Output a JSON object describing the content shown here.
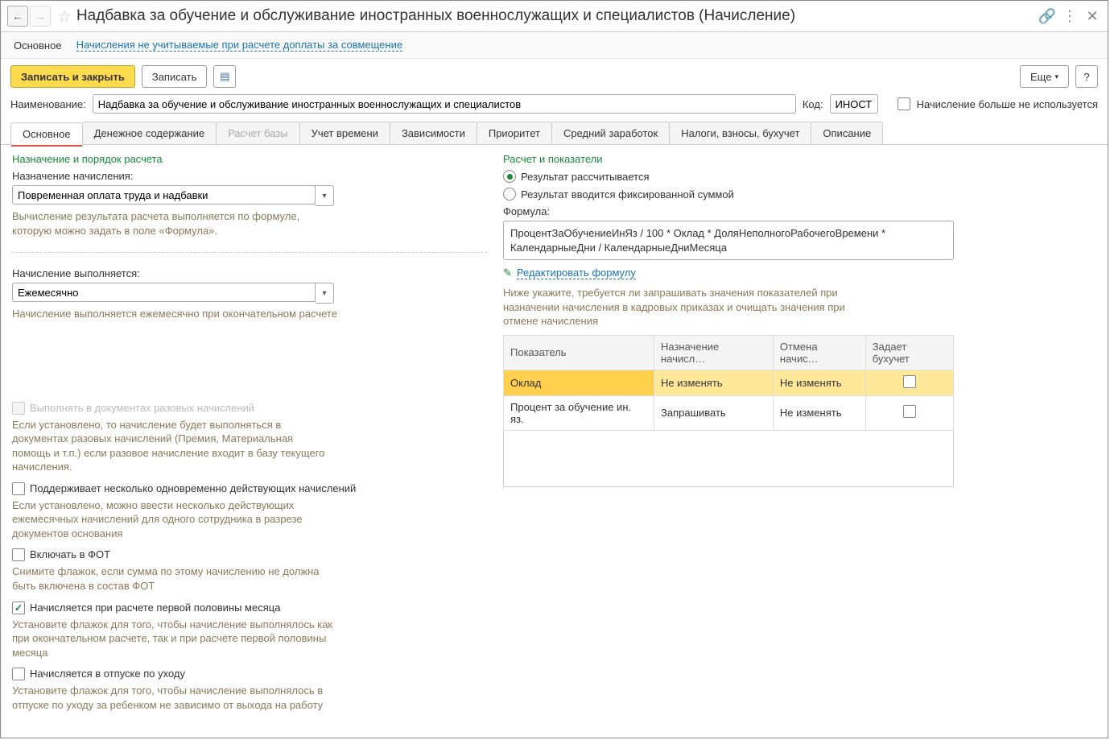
{
  "header": {
    "title": "Надбавка за обучение и обслуживание иностранных военнослужащих и специалистов (Начисление)"
  },
  "subheader": {
    "main": "Основное",
    "link": "Начисления не учитываемые при расчете доплаты за совмещение"
  },
  "toolbar": {
    "save_close": "Записать и закрыть",
    "save": "Записать",
    "more": "Еще",
    "help": "?"
  },
  "form": {
    "name_label": "Наименование:",
    "name_value": "Надбавка за обучение и обслуживание иностранных военнослужащих и специалистов",
    "code_label": "Код:",
    "code_value": "ИНОСТ",
    "not_used_label": "Начисление больше не используется"
  },
  "tabs": [
    "Основное",
    "Денежное содержание",
    "Расчет базы",
    "Учет времени",
    "Зависимости",
    "Приоритет",
    "Средний заработок",
    "Налоги, взносы, бухучет",
    "Описание"
  ],
  "left": {
    "section": "Назначение и порядок расчета",
    "purpose_label": "Назначение начисления:",
    "purpose_value": "Повременная оплата труда и надбавки",
    "purpose_hint": "Вычисление результата расчета выполняется по формуле, которую можно задать в поле «Формула».",
    "exec_label": "Начисление выполняется:",
    "exec_value": "Ежемесячно",
    "exec_hint": "Начисление выполняется ежемесячно при окончательном расчете",
    "chk1_label": "Выполнять в документах разовых начислений",
    "chk1_hint": "Если установлено, то начисление будет выполняться в документах разовых начислений (Премия, Материальная помощь и т.п.) если разовое начисление входит в базу текущего начисления.",
    "chk2_label": "Поддерживает несколько одновременно действующих начислений",
    "chk2_hint": "Если установлено, можно ввести несколько действующих ежемесячных начислений для одного сотрудника в разрезе документов основания",
    "chk3_label": "Включать в ФОТ",
    "chk3_hint": "Снимите флажок, если сумма по этому начислению не должна быть включена в состав ФОТ",
    "chk4_label": "Начисляется при расчете первой половины месяца",
    "chk4_hint": "Установите флажок для того, чтобы начисление выполнялось как при окончательном расчете, так и при расчете первой половины месяца",
    "chk5_label": "Начисляется в отпуске по уходу",
    "chk5_hint": "Установите флажок для того, чтобы начисление выполнялось в отпуске по уходу за ребенком не зависимо от выхода на работу"
  },
  "right": {
    "section": "Расчет и показатели",
    "radio1": "Результат рассчитывается",
    "radio2": "Результат вводится фиксированной суммой",
    "formula_label": "Формула:",
    "formula_value": "ПроцентЗаОбучениеИнЯз / 100 * Оклад * ДоляНеполногоРабочегоВремени * КалендарныеДни / КалендарныеДниМесяца",
    "edit_link": "Редактировать формулу",
    "table_hint": "Ниже укажите, требуется ли запрашивать значения показателей при назначении начисления в кадровых приказах и очищать значения при отмене начисления",
    "table": {
      "headers": [
        "Показатель",
        "Назначение начисл…",
        "Отмена начис…",
        "Задает бухучет"
      ],
      "rows": [
        {
          "indicator": "Оклад",
          "assign": "Не изменять",
          "cancel": "Не изменять",
          "acc": false,
          "selected": true
        },
        {
          "indicator": "Процент за обучение ин. яз.",
          "assign": "Запрашивать",
          "cancel": "Не изменять",
          "acc": false,
          "selected": false
        }
      ]
    }
  }
}
